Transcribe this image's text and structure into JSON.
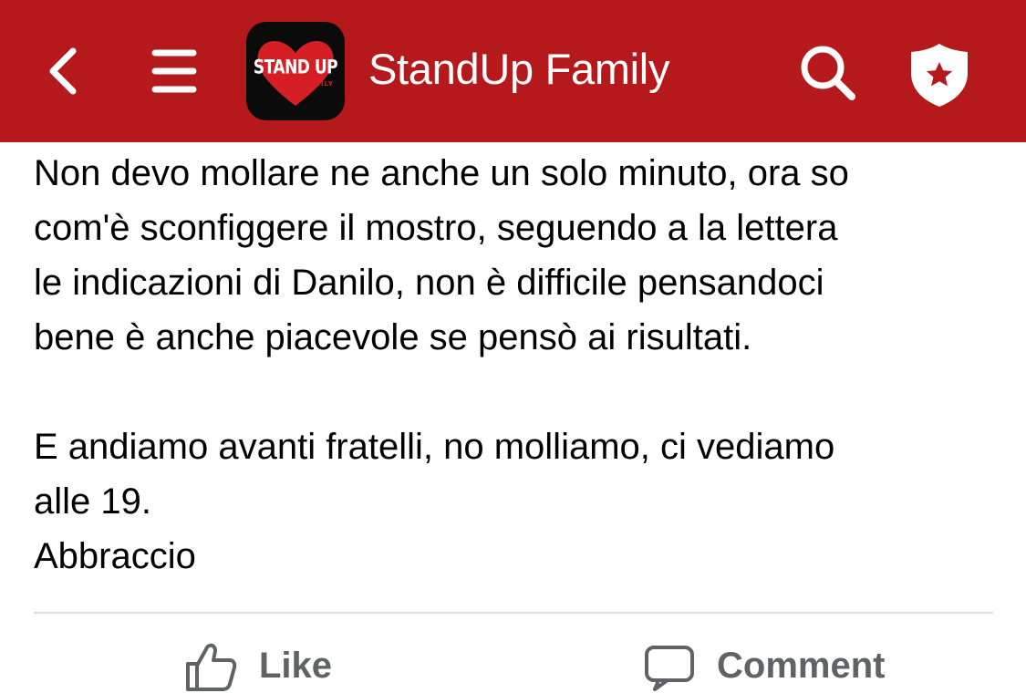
{
  "colors": {
    "brand": "#b5191c",
    "header_icon": "#ffffff",
    "text": "#000000",
    "action_text": "#606266"
  },
  "header": {
    "back_icon": "chevron-left-icon",
    "menu_icon": "hamburger-menu-icon",
    "logo": {
      "text": "STAND UP",
      "subtext": "FAMILY"
    },
    "title": "StandUp Family",
    "search_icon": "search-icon",
    "shield_icon": "shield-star-icon"
  },
  "post": {
    "paragraph_1": "Non devo mollare ne anche un solo minuto, ora so\ncom'è sconfiggere il mostro, seguendo a la lettera\nle indicazioni di Danilo, non è difficile pensandoci\nbene è anche piacevole se pensò ai risultati.",
    "paragraph_2": "E andiamo avanti fratelli, no molliamo, ci vediamo\nalle 19.\nAbbraccio"
  },
  "actions": {
    "like_label": "Like",
    "like_icon": "thumbs-up-icon",
    "comment_label": "Comment",
    "comment_icon": "comment-icon"
  }
}
